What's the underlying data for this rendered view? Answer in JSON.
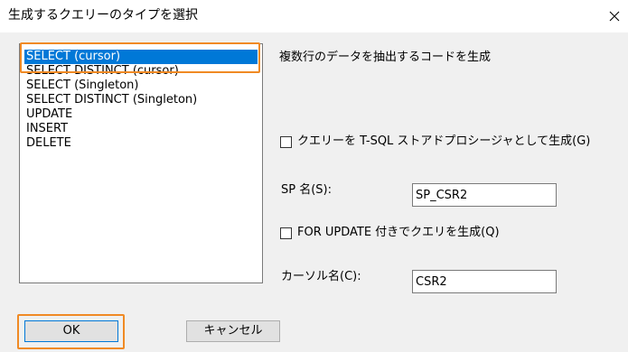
{
  "window": {
    "title": "生成するクエリーのタイプを選択",
    "close_glyph": "✕"
  },
  "query_types": {
    "items": [
      "SELECT (cursor)",
      "SELECT DISTINCT (cursor)",
      "SELECT (Singleton)",
      "SELECT DISTINCT (Singleton)",
      "UPDATE",
      "INSERT",
      "DELETE"
    ],
    "selected_index": 0
  },
  "description": "複数行のデータを抽出するコードを生成",
  "options": {
    "generate_sp_label": "クエリーを T-SQL ストアドプロシージャとして生成(G)",
    "generate_sp_checked": false,
    "sp_name_label": "SP 名(S):",
    "sp_name_value": "SP_CSR2",
    "for_update_label": "FOR UPDATE 付きでクエリを生成(Q)",
    "for_update_checked": false,
    "cursor_name_label": "カーソル名(C):",
    "cursor_name_value": "CSR2"
  },
  "buttons": {
    "ok": "OK",
    "cancel": "キャンセル"
  },
  "colors": {
    "selection": "#0078d7",
    "highlight": "#f08a24",
    "dialog_bg": "#f0f0f0"
  }
}
